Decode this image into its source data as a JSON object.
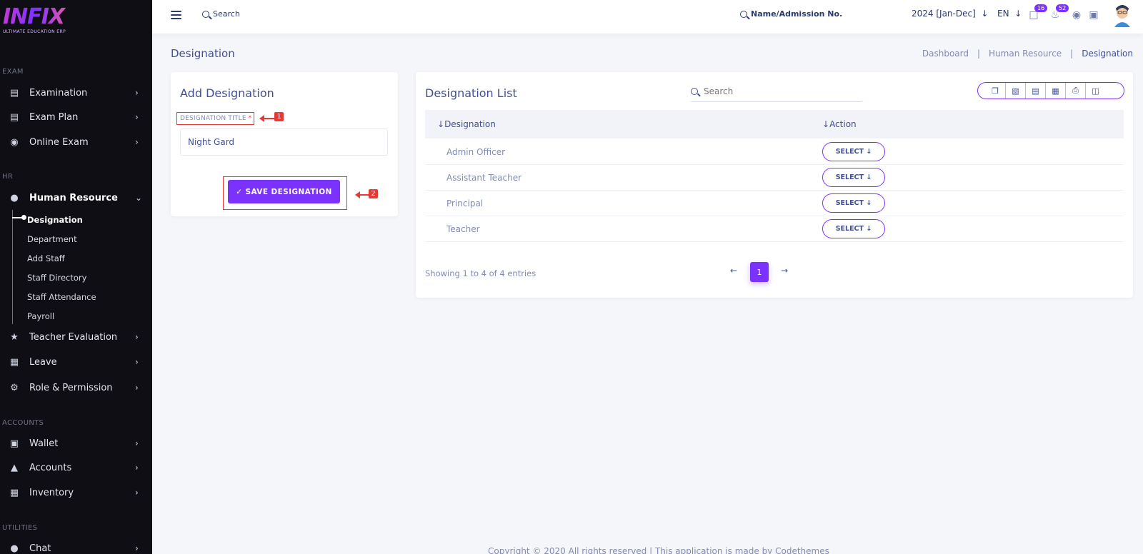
{
  "brand": {
    "logo": "INFIX",
    "tagline": "ULTIMATE EDUCATION ERP"
  },
  "sidebar": {
    "sections": {
      "exam": "EXAM",
      "hr": "HR",
      "accounts": "ACCOUNTS",
      "utilities": "UTILITIES"
    },
    "items": {
      "examination": "Examination",
      "exam_plan": "Exam Plan",
      "online_exam": "Online Exam",
      "human_resource": "Human Resource",
      "teacher_evaluation": "Teacher Evaluation",
      "leave": "Leave",
      "role_permission": "Role & Permission",
      "wallet": "Wallet",
      "accounts": "Accounts",
      "inventory": "Inventory",
      "chat": "Chat"
    },
    "hr_sub": {
      "designation": "Designation",
      "department": "Department",
      "add_staff": "Add Staff",
      "staff_directory": "Staff Directory",
      "staff_attendance": "Staff Attendance",
      "payroll": "Payroll"
    }
  },
  "header": {
    "search_label": "Search",
    "search2_label": "Name/Admission No.",
    "year": "2024 [Jan-Dec]",
    "lang": "EN",
    "chat_badge": "16",
    "notif_badge": "52"
  },
  "page": {
    "title": "Designation",
    "breadcrumb": [
      "Dashboard",
      "Human Resource",
      "Designation"
    ]
  },
  "add_form": {
    "title": "Add Designation",
    "field_label": "DESIGNATION TITLE",
    "required_mark": "*",
    "field_value": "Night Gard",
    "save_label": "SAVE DESIGNATION"
  },
  "list": {
    "title": "Designation List",
    "search_placeholder": "Search",
    "col_designation": "Designation",
    "col_action": "Action",
    "select_label": "SELECT",
    "rows": [
      "Admin Officer",
      "Assistant Teacher",
      "Principal",
      "Teacher"
    ],
    "showing": "Showing 1 to 4 of 4 entries",
    "current_page": "1"
  },
  "annotations": {
    "a1": "1",
    "a2": "2"
  },
  "footer": "Copyright © 2020 All rights reserved | This application is made by Codethemes",
  "colors": {
    "accent": "#7c32ff",
    "sidebar": "#0e0e14",
    "text": "#415094",
    "annotation": "#e53935"
  }
}
